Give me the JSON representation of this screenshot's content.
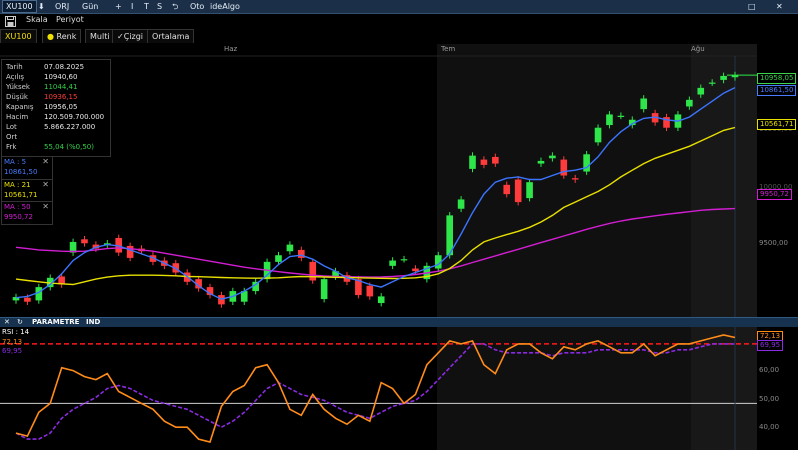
{
  "titlebar": {
    "symbol": "XU100",
    "items": [
      "⬇",
      "ORJ",
      "Gün",
      "+",
      "I",
      "T",
      "S",
      "⮌",
      "Oto",
      "ideAlgo"
    ],
    "maximize": "□",
    "close": "✕"
  },
  "toolbar": {
    "scale": "Skala",
    "period": "Periyot"
  },
  "tabs": [
    {
      "label": "XU100"
    },
    {
      "label": "Renk"
    },
    {
      "label": "Multi"
    },
    {
      "label": "✓Çizgi"
    },
    {
      "label": "Ortalama"
    }
  ],
  "x_axis_labels": [
    "Haz",
    "Tem",
    "Ağu"
  ],
  "info": {
    "rows": [
      {
        "k": "Tarih",
        "v": "07.08.2025",
        "color": "#e8e8e8"
      },
      {
        "k": "Açılış",
        "v": "10940,60",
        "color": "#e8e8e8"
      },
      {
        "k": "Yüksek",
        "v": "11044,41",
        "color": "#33d14a"
      },
      {
        "k": "Düşük",
        "v": "10936,15",
        "color": "#ff3b3b"
      },
      {
        "k": "Kapanış",
        "v": "10956,05",
        "color": "#e8e8e8"
      },
      {
        "k": "Hacim",
        "v": "120.509.700.000",
        "color": "#e8e8e8"
      },
      {
        "k": "Lot",
        "v": "5.866.227.000",
        "color": "#e8e8e8"
      },
      {
        "k": "Ort",
        "v": "",
        "color": "#e8e8e8"
      },
      {
        "k": "Frk",
        "v": "55,04 (%0,50)",
        "color": "#33d14a"
      }
    ]
  },
  "ma": [
    {
      "label": "MA : 5",
      "value": "10861,50",
      "color": "#4a7cff"
    },
    {
      "label": "MA : 21",
      "value": "10561,71",
      "color": "#e8e000"
    },
    {
      "label": "MA : 50",
      "value": "9950,72",
      "color": "#d21ed2"
    }
  ],
  "price_axis": {
    "ticks": [
      "10500,00",
      "10000,00",
      "9500,00"
    ],
    "tags": [
      {
        "v": "10958,05",
        "color": "#3cd24a"
      },
      {
        "v": "10861,50",
        "color": "#4a7cff"
      },
      {
        "v": "10561,71",
        "color": "#e8e000"
      },
      {
        "v": "9950,72",
        "color": "#d21ed2"
      }
    ]
  },
  "rsi_panel": {
    "header": "PARAMETRE",
    "ind": "IND",
    "title": "RSI : 14",
    "value": "72,13",
    "signal": "69,95",
    "ticks": [
      "60,00",
      "50,00",
      "40,00"
    ],
    "tags": [
      {
        "v": "72,13",
        "color": "#ff8c1a"
      },
      {
        "v": "69,95",
        "color": "#8a2be2"
      }
    ]
  },
  "colors": {
    "bull": "#2ee64a",
    "bear": "#ff3b3b",
    "ma5": "#3b74ff",
    "ma21": "#e8e000",
    "ma50": "#d21ed2",
    "rsi": "#ff8c1a",
    "rsi_signal": "#8a2be2"
  },
  "chart_data": {
    "type": "line",
    "candles": [
      {
        "o": 9260,
        "c": 9285
      },
      {
        "o": 9280,
        "c": 9250
      },
      {
        "o": 9260,
        "c": 9360
      },
      {
        "o": 9360,
        "c": 9430
      },
      {
        "o": 9440,
        "c": 9380
      },
      {
        "o": 9620,
        "c": 9700
      },
      {
        "o": 9720,
        "c": 9690
      },
      {
        "o": 9680,
        "c": 9650
      },
      {
        "o": 9680,
        "c": 9690
      },
      {
        "o": 9730,
        "c": 9620
      },
      {
        "o": 9670,
        "c": 9580
      },
      {
        "o": 9650,
        "c": 9630
      },
      {
        "o": 9600,
        "c": 9550
      },
      {
        "o": 9560,
        "c": 9520
      },
      {
        "o": 9540,
        "c": 9470
      },
      {
        "o": 9470,
        "c": 9400
      },
      {
        "o": 9420,
        "c": 9350
      },
      {
        "o": 9360,
        "c": 9300
      },
      {
        "o": 9300,
        "c": 9230
      },
      {
        "o": 9250,
        "c": 9330
      },
      {
        "o": 9250,
        "c": 9330
      },
      {
        "o": 9330,
        "c": 9400
      },
      {
        "o": 9420,
        "c": 9550
      },
      {
        "o": 9550,
        "c": 9600
      },
      {
        "o": 9630,
        "c": 9680
      },
      {
        "o": 9640,
        "c": 9580
      },
      {
        "o": 9550,
        "c": 9410
      },
      {
        "o": 9270,
        "c": 9420
      },
      {
        "o": 9440,
        "c": 9480
      },
      {
        "o": 9450,
        "c": 9400
      },
      {
        "o": 9420,
        "c": 9300
      },
      {
        "o": 9370,
        "c": 9290
      },
      {
        "o": 9240,
        "c": 9290
      },
      {
        "o": 9520,
        "c": 9560
      },
      {
        "o": 9570,
        "c": 9570
      },
      {
        "o": 9500,
        "c": 9480
      },
      {
        "o": 9420,
        "c": 9520
      },
      {
        "o": 9500,
        "c": 9600
      },
      {
        "o": 9600,
        "c": 9900
      },
      {
        "o": 9950,
        "c": 10020
      },
      {
        "o": 10250,
        "c": 10350
      },
      {
        "o": 10320,
        "c": 10280
      },
      {
        "o": 10340,
        "c": 10290
      },
      {
        "o": 10130,
        "c": 10060
      },
      {
        "o": 10170,
        "c": 10000
      },
      {
        "o": 10030,
        "c": 10150
      },
      {
        "o": 10290,
        "c": 10310
      },
      {
        "o": 10330,
        "c": 10350
      },
      {
        "o": 10320,
        "c": 10200
      },
      {
        "o": 10180,
        "c": 10170
      },
      {
        "o": 10230,
        "c": 10360
      },
      {
        "o": 10450,
        "c": 10560
      },
      {
        "o": 10580,
        "c": 10660
      },
      {
        "o": 10650,
        "c": 10650
      },
      {
        "o": 10580,
        "c": 10620
      },
      {
        "o": 10700,
        "c": 10780
      },
      {
        "o": 10670,
        "c": 10600
      },
      {
        "o": 10640,
        "c": 10560
      },
      {
        "o": 10560,
        "c": 10660
      },
      {
        "o": 10720,
        "c": 10770
      },
      {
        "o": 10810,
        "c": 10860
      },
      {
        "o": 10900,
        "c": 10900
      },
      {
        "o": 10920,
        "c": 10950
      },
      {
        "o": 10940,
        "c": 10956
      }
    ],
    "ma5": [
      9280,
      9290,
      9320,
      9380,
      9460,
      9560,
      9620,
      9660,
      9680,
      9670,
      9640,
      9610,
      9580,
      9540,
      9500,
      9440,
      9370,
      9310,
      9270,
      9290,
      9330,
      9380,
      9450,
      9530,
      9590,
      9600,
      9570,
      9520,
      9480,
      9430,
      9410,
      9380,
      9360,
      9400,
      9440,
      9470,
      9500,
      9530,
      9610,
      9760,
      9920,
      10060,
      10150,
      10180,
      10190,
      10170,
      10170,
      10200,
      10230,
      10240,
      10260,
      10340,
      10450,
      10530,
      10590,
      10630,
      10640,
      10620,
      10610,
      10640,
      10700,
      10760,
      10820,
      10862
    ],
    "ma21": [
      9420,
      9410,
      9400,
      9390,
      9385,
      9380,
      9400,
      9420,
      9435,
      9445,
      9450,
      9450,
      9450,
      9448,
      9445,
      9440,
      9438,
      9435,
      9432,
      9430,
      9428,
      9427,
      9428,
      9430,
      9435,
      9440,
      9438,
      9436,
      9434,
      9432,
      9430,
      9428,
      9426,
      9425,
      9426,
      9430,
      9440,
      9460,
      9500,
      9560,
      9640,
      9700,
      9730,
      9755,
      9780,
      9810,
      9850,
      9900,
      9960,
      10000,
      10040,
      10080,
      10130,
      10190,
      10240,
      10290,
      10330,
      10360,
      10390,
      10420,
      10460,
      10500,
      10540,
      10562
    ],
    "ma50": [
      9660,
      9650,
      9640,
      9635,
      9630,
      9628,
      9630,
      9640,
      9650,
      9655,
      9650,
      9640,
      9630,
      9615,
      9600,
      9585,
      9570,
      9555,
      9540,
      9525,
      9510,
      9498,
      9487,
      9476,
      9466,
      9458,
      9450,
      9444,
      9440,
      9438,
      9436,
      9435,
      9436,
      9440,
      9446,
      9455,
      9466,
      9480,
      9498,
      9520,
      9545,
      9570,
      9595,
      9620,
      9645,
      9670,
      9695,
      9720,
      9745,
      9770,
      9795,
      9818,
      9840,
      9858,
      9873,
      9885,
      9897,
      9908,
      9918,
      9928,
      9938,
      9944,
      9948,
      9951
    ],
    "rsi": [
      40,
      39,
      47,
      50,
      62,
      61,
      59,
      58,
      60,
      54,
      52,
      50,
      48,
      44,
      42,
      42,
      38,
      37,
      49,
      54,
      56,
      62,
      63,
      57,
      48,
      46,
      53,
      48,
      45,
      43,
      46,
      44,
      57,
      55,
      50,
      53,
      63,
      67,
      71,
      70,
      71,
      63,
      60,
      68,
      70,
      70,
      67,
      65,
      69,
      68,
      70,
      71,
      69,
      67,
      67,
      70,
      66,
      68,
      70,
      70,
      71,
      72,
      73,
      72.13
    ],
    "rsi_signal": [
      40,
      38,
      38,
      40,
      45,
      48,
      50,
      52,
      55,
      56,
      55,
      53,
      51,
      50,
      49,
      48,
      46,
      44,
      42,
      44,
      47,
      51,
      55,
      57,
      55,
      53,
      52,
      51,
      49,
      47,
      46,
      45,
      47,
      49,
      50,
      51,
      54,
      58,
      62,
      66,
      70,
      70,
      68,
      67,
      67,
      67,
      67,
      66,
      67,
      67,
      67,
      68,
      68,
      68,
      68,
      68,
      67,
      67,
      68,
      68,
      69,
      70,
      70,
      69.95
    ],
    "price_range": [
      9150,
      11100
    ],
    "rsi_range": [
      35,
      75
    ],
    "rsi_threshold": 70
  }
}
